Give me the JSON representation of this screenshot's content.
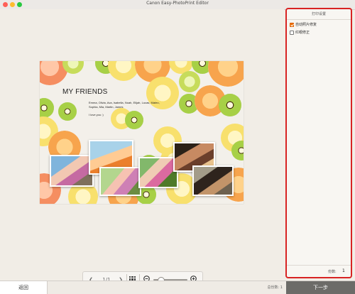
{
  "window": {
    "title": "Canon Easy-PhotoPrint Editor"
  },
  "card": {
    "title": "MY FRIENDS",
    "names": "Emma, Olivia, Ava, Isabella, Noah, Elijah, Lucas, Mateo, Sophia, Mia, Martin, James",
    "message": "I love you :)"
  },
  "toolbar": {
    "page_indicator": "1/1",
    "prev_icon": "chevron-left-icon",
    "next_icon": "chevron-right-icon",
    "zoom_level": 0.15
  },
  "panel": {
    "header": "打印设置",
    "options": [
      {
        "label": "自动照片修复",
        "checked": true
      },
      {
        "label": "红眼修正",
        "checked": false
      }
    ],
    "copies_label": "份数:",
    "copies_value": "1"
  },
  "footer": {
    "back_label": "返回",
    "total_label": "总份数: 1",
    "next_label": "下一步"
  },
  "colors": {
    "panel_border": "#d82323",
    "checkbox_accent": "#ef6d00",
    "next_button": "#6c6b68"
  }
}
